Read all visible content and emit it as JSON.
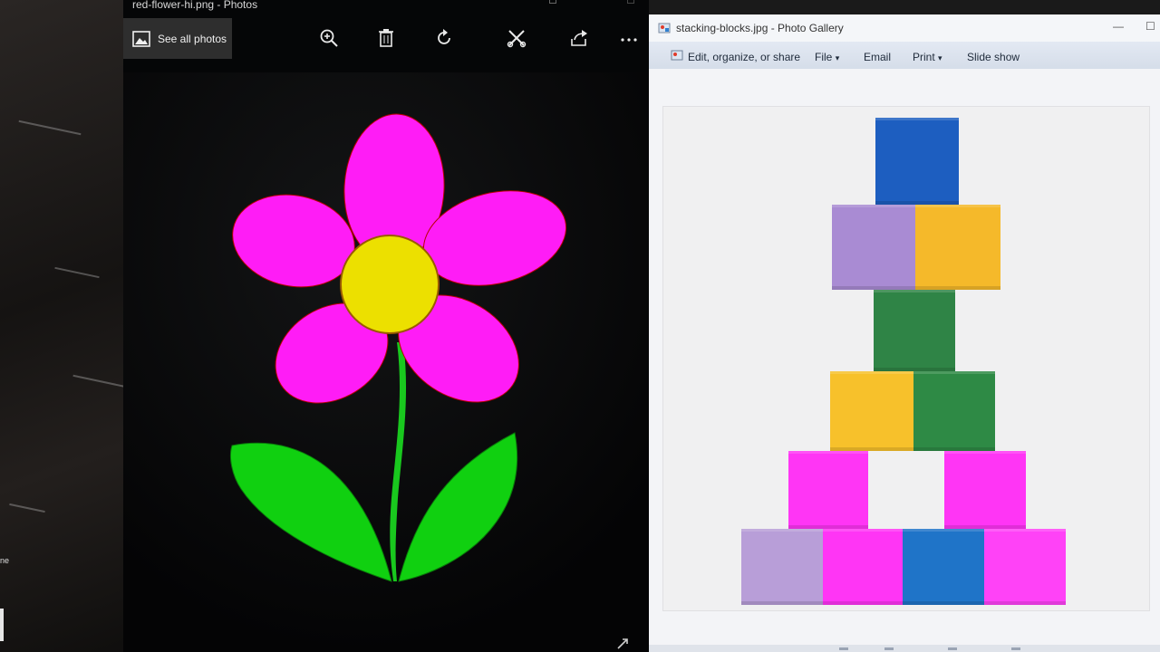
{
  "photos_app": {
    "title": "red-flower-hi.png - Photos",
    "see_all_label": "See all photos",
    "toolbar": [
      {
        "name": "zoom-in-icon",
        "glyph": "zoom"
      },
      {
        "name": "delete-icon",
        "glyph": "trash"
      },
      {
        "name": "rotate-icon",
        "glyph": "rotate"
      },
      {
        "name": "edit-crop-icon",
        "glyph": "crop"
      },
      {
        "name": "share-icon",
        "glyph": "share"
      },
      {
        "name": "more-icon",
        "glyph": "more"
      }
    ],
    "image": {
      "petal_color": "#ff1cf6",
      "center_color": "#ece000",
      "stem_color": "#19c81e",
      "leaf_color": "#10d010",
      "outline_color": "#b80000"
    }
  },
  "gallery_app": {
    "title": "stacking-blocks.jpg - Photo Gallery",
    "menu": [
      {
        "label": "Edit, organize, or share",
        "dropdown": false
      },
      {
        "label": "File",
        "dropdown": true
      },
      {
        "label": "Email",
        "dropdown": false
      },
      {
        "label": "Print",
        "dropdown": true
      },
      {
        "label": "Slide show",
        "dropdown": false
      }
    ],
    "dropdown_glyph": "▾",
    "blocks": [
      {
        "row": 1,
        "color": "#1d5ec0"
      },
      {
        "row": 2,
        "color": "#a98bd3"
      },
      {
        "row": 2,
        "color": "#f5b92a"
      },
      {
        "row": 3,
        "color": "#2f8446"
      },
      {
        "row": 4,
        "color": "#f7c12b"
      },
      {
        "row": 4,
        "color": "#2e8a45"
      },
      {
        "row": 5,
        "color": "#ff35f5"
      },
      {
        "row": 5,
        "color": "#ff35f5"
      },
      {
        "row": 6,
        "color": "#b89ed8"
      },
      {
        "row": 6,
        "color": "#ff35f5"
      },
      {
        "row": 6,
        "color": "#1f74c8"
      },
      {
        "row": 6,
        "color": "#ff42f7"
      }
    ]
  },
  "desktop": {
    "left_text": "ne"
  }
}
